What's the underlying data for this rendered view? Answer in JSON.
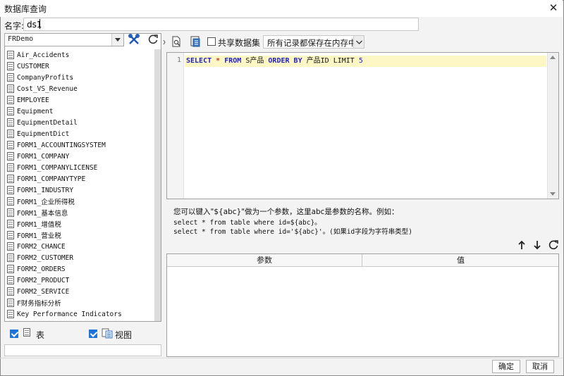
{
  "window": {
    "title": "数据库查询",
    "close_glyph": "✕"
  },
  "name_field": {
    "label": "名字:",
    "value": "ds1"
  },
  "left": {
    "connection": "FRDemo",
    "tables": [
      "Air_Accidents",
      "CUSTOMER",
      "CompanyProfits",
      "Cost_VS_Revenue",
      "EMPLOYEE",
      "Equipment",
      "EquipmentDetail",
      "EquipmentDict",
      "FORM1_ACCOUNTINGSYSTEM",
      "FORM1_COMPANY",
      "FORM1_COMPANYLICENSE",
      "FORM1_COMPANYTYPE",
      "FORM1_INDUSTRY",
      "FORM1_企业所得税",
      "FORM1_基本信息",
      "FORM1_增值税",
      "FORM1_营业税",
      "FORM2_CHANCE",
      "FORM2_CUSTOMER",
      "FORM2_ORDERS",
      "FORM2_PRODUCT",
      "FORM2_SERVICE",
      "F财务指标分析",
      "Key Performance Indicators"
    ],
    "filter_table_label": "表",
    "filter_view_label": "视图"
  },
  "toolbar": {
    "share_label": "共享数据集",
    "storage_mode": "所有记录都保存在内存中"
  },
  "editor": {
    "line_number": "1",
    "sql": {
      "select": "SELECT",
      "star": "*",
      "from": "FROM",
      "table": "S产品",
      "order": "ORDER",
      "by": "BY",
      "column": "产品ID",
      "limit": "LIMIT",
      "count": "5"
    }
  },
  "hints": {
    "line1": "您可以键入\"${abc}\"做为一个参数，这里abc是参数的名称。例如：",
    "line2": "select * from table where id=${abc}。",
    "line3": "select * from table where id='${abc}'。(如果id字段为字符串类型)"
  },
  "params": {
    "col_param": "参数",
    "col_value": "值"
  },
  "buttons": {
    "ok": "确定",
    "cancel": "取消"
  }
}
